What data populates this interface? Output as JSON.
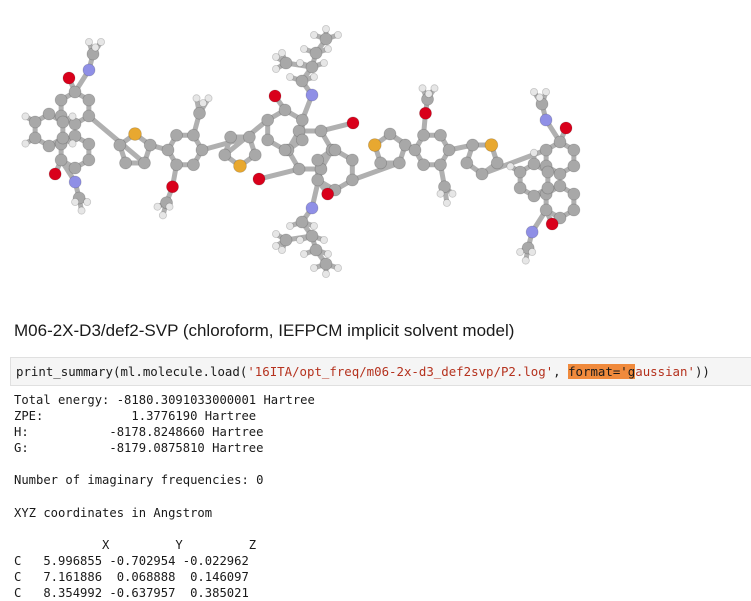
{
  "heading": "M06-2X-D3/def2-SVP (chloroform, IEFPCM implicit solvent model)",
  "code_cell": {
    "fn1": "print_summary",
    "p1": "(",
    "fn2": "ml",
    "dot1": ".",
    "fn3": "molecule",
    "dot2": ".",
    "fn4": "load",
    "p2": "(",
    "path": "'16ITA/opt_freq/m06-2x-d3_def2svp/P2.log'",
    "comma": ", ",
    "kw": "format='",
    "cursor_char": "g",
    "kw_rest": "aussian'",
    "p3": "))"
  },
  "output": {
    "total_energy": "Total energy: -8180.3091033000001 Hartree",
    "zpe": "ZPE:            1.3776190 Hartree",
    "h": "H:           -8178.8248660 Hartree",
    "g": "G:           -8179.0875810 Hartree",
    "blank1": "",
    "imag": "Number of imaginary frequencies: 0",
    "blank2": "",
    "xyz_title": "XYZ coordinates in Angstrom",
    "blank3": "",
    "xyz_header": "            X         Y         Z",
    "rows": [
      "C   5.996855 -0.702954 -0.022962",
      "C   7.161886  0.068888  0.146097",
      "C   8.354992 -0.637957  0.385021"
    ]
  },
  "colors": {
    "carbon": "#a8a8a8",
    "hydrogen": "#e6e6e6",
    "oxygen": "#d9001b",
    "nitrogen": "#8f8fe6",
    "sulfur": "#e8a830",
    "highlight": "#f08a3c",
    "string": "#b5321e"
  }
}
